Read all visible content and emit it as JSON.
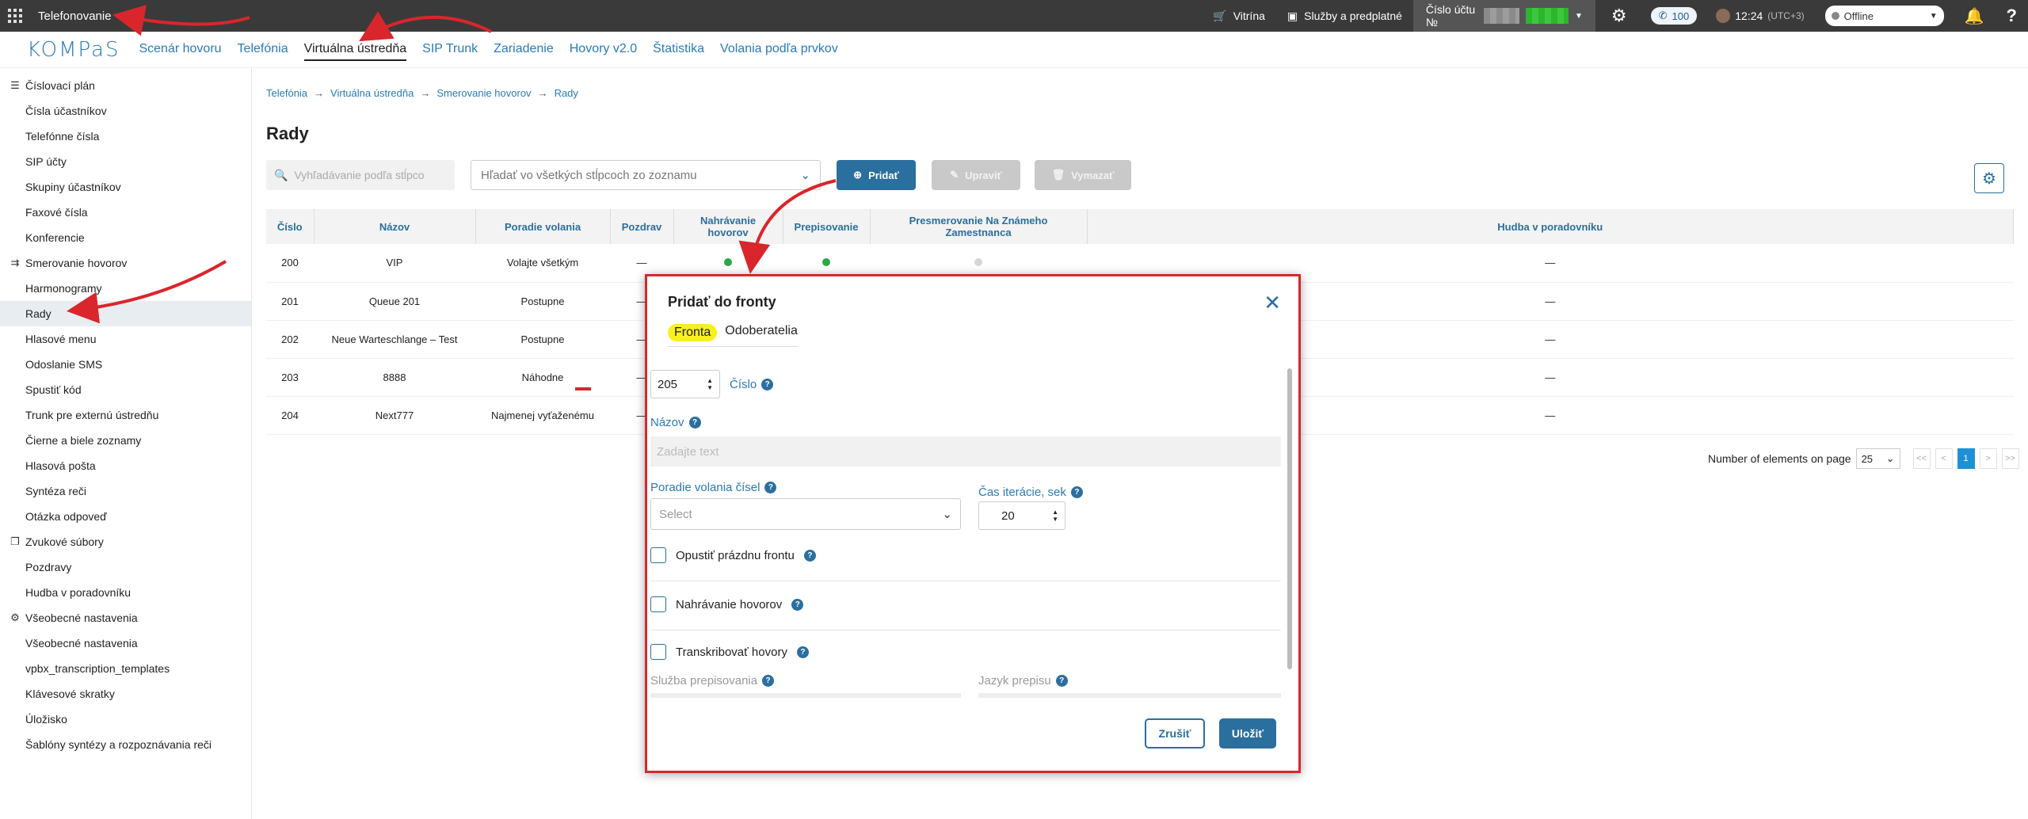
{
  "topbar": {
    "app_title": "Telefonovanie",
    "showcase": "Vitrína",
    "services": "Služby a predplatné",
    "account_label": "Číslo účtu №",
    "calls_count": "100",
    "time": "12:24",
    "timezone": "(UTC+3)",
    "status": "Offline"
  },
  "nav": {
    "logo": "KOMPaS",
    "logo_suffix": "aaS",
    "links": [
      "Scenár hovoru",
      "Telefónia",
      "Virtuálna ústredňa",
      "SIP Trunk",
      "Zariadenie",
      "Hovory v2.0",
      "Štatistika",
      "Volania podľa prvkov"
    ]
  },
  "sidebar": {
    "groups": [
      {
        "title": "Číslovací plán",
        "items": [
          "Čísla účastníkov",
          "Telefónne čísla",
          "SIP účty",
          "Skupiny účastníkov",
          "Faxové čísla",
          "Konferencie"
        ]
      },
      {
        "title": "Smerovanie hovorov",
        "items": [
          "Harmonogramy",
          "Rady",
          "Hlasové menu",
          "Odoslanie SMS",
          "Spustiť kód",
          "Trunk pre externú ústredňu",
          "Čierne a biele zoznamy",
          "Hlasová pošta",
          "Syntéza reči",
          "Otázka odpoveď"
        ]
      },
      {
        "title": "Zvukové súbory",
        "items": [
          "Pozdravy",
          "Hudba v poradovníku"
        ]
      },
      {
        "title": "Všeobecné nastavenia",
        "items": [
          "Všeobecné nastavenia",
          "vpbx_transcription_templates",
          "Klávesové skratky",
          "Úložisko",
          "Šablóny syntézy a rozpoznávania reči"
        ]
      }
    ]
  },
  "breadcrumb": [
    "Telefónia",
    "Virtuálna ústredňa",
    "Smerovanie hovorov",
    "Rady"
  ],
  "page_title": "Rady",
  "toolbar": {
    "search_placeholder": "Vyhľadávanie podľa stĺpco",
    "filter_placeholder": "Hľadať vo všetkých stĺpcoch zo zoznamu",
    "add": "Pridať",
    "edit": "Upraviť",
    "delete": "Vymazať"
  },
  "table": {
    "headers": [
      "Číslo",
      "Názov",
      "Poradie volania",
      "Pozdrav",
      "Nahrávanie hovorov",
      "Prepisovanie",
      "Presmerovanie Na Známeho Zamestnanca",
      "Hudba v poradovníku"
    ],
    "rows": [
      [
        "200",
        "VIP",
        "Volajte všetkým",
        "—",
        "",
        "",
        "",
        "—"
      ],
      [
        "201",
        "Queue 201",
        "Postupne",
        "—",
        "",
        "",
        "",
        "—"
      ],
      [
        "202",
        "Neue Warteschlange – Test",
        "Postupne",
        "—",
        "",
        "",
        "",
        "—"
      ],
      [
        "203",
        "8888",
        "Náhodne",
        "—",
        "",
        "",
        "",
        "—"
      ],
      [
        "204",
        "Next777",
        "Najmenej vyťaženému",
        "—",
        "",
        "",
        "",
        "—"
      ]
    ]
  },
  "pager": {
    "label": "Number of elements on page",
    "size": "25",
    "current": "1",
    "first": "<<",
    "prev": "<",
    "next": ">",
    "last": ">>"
  },
  "modal": {
    "title": "Pridať do fronty",
    "tabs": [
      "Fronta",
      "Odoberatelia"
    ],
    "number_value": "205",
    "number_label": "Číslo",
    "name_label": "Názov",
    "name_placeholder": "Zadajte text",
    "order_label": "Poradie volania čísel",
    "order_placeholder": "Select",
    "iteration_label": "Čas iterácie, sek",
    "iteration_value": "20",
    "leave_empty": "Opustiť prázdnu frontu",
    "recording": "Nahrávanie hovorov",
    "transcribe": "Transkribovať hovory",
    "transcribe_service": "Služba prepisovania",
    "transcribe_language": "Jazyk prepisu",
    "cancel": "Zrušiť",
    "save": "Uložiť",
    "help_mark": "?"
  },
  "colors": {
    "accent": "#2a6f9e",
    "link": "#2a7ab8",
    "annotation": "#d9262c",
    "highlight": "#f7ef22",
    "on": "#2aa845",
    "off": "#d6d6d6"
  }
}
